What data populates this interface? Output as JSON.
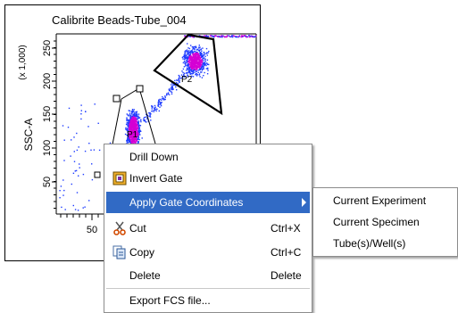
{
  "plot": {
    "title": "Calibrite Beads-Tube_004",
    "y_axis_label": "SSC-A",
    "y_multiplier": "(x 1,000)",
    "y_ticks": [
      "250",
      "200",
      "150",
      "100",
      "50"
    ],
    "x_ticks": [
      "50"
    ],
    "gate_labels": [
      "P1",
      "P2"
    ],
    "colors": {
      "events_dense": "#d400d4",
      "events_sparse": "#1e3cff",
      "gate_line": "#000000"
    }
  },
  "context_menu": {
    "items": [
      {
        "label": "Drill Down",
        "shortcut": "",
        "icon": ""
      },
      {
        "label": "Invert Gate",
        "shortcut": "",
        "icon": "invert-gate-icon"
      },
      {
        "label": "Apply Gate Coordinates",
        "shortcut": "",
        "icon": "",
        "has_submenu": true,
        "highlighted": true
      },
      {
        "label": "Cut",
        "shortcut": "Ctrl+X",
        "icon": "scissors-icon"
      },
      {
        "label": "Copy",
        "shortcut": "Ctrl+C",
        "icon": "copy-icon"
      },
      {
        "label": "Delete",
        "shortcut": "Delete",
        "icon": ""
      },
      {
        "label": "Export FCS file...",
        "shortcut": "",
        "icon": ""
      }
    ]
  },
  "submenu": {
    "items": [
      "Current Experiment",
      "Current Specimen",
      "Tube(s)/Well(s)"
    ]
  },
  "colors": {
    "highlight": "#316ac5",
    "menu_border": "#8c8c8c"
  }
}
